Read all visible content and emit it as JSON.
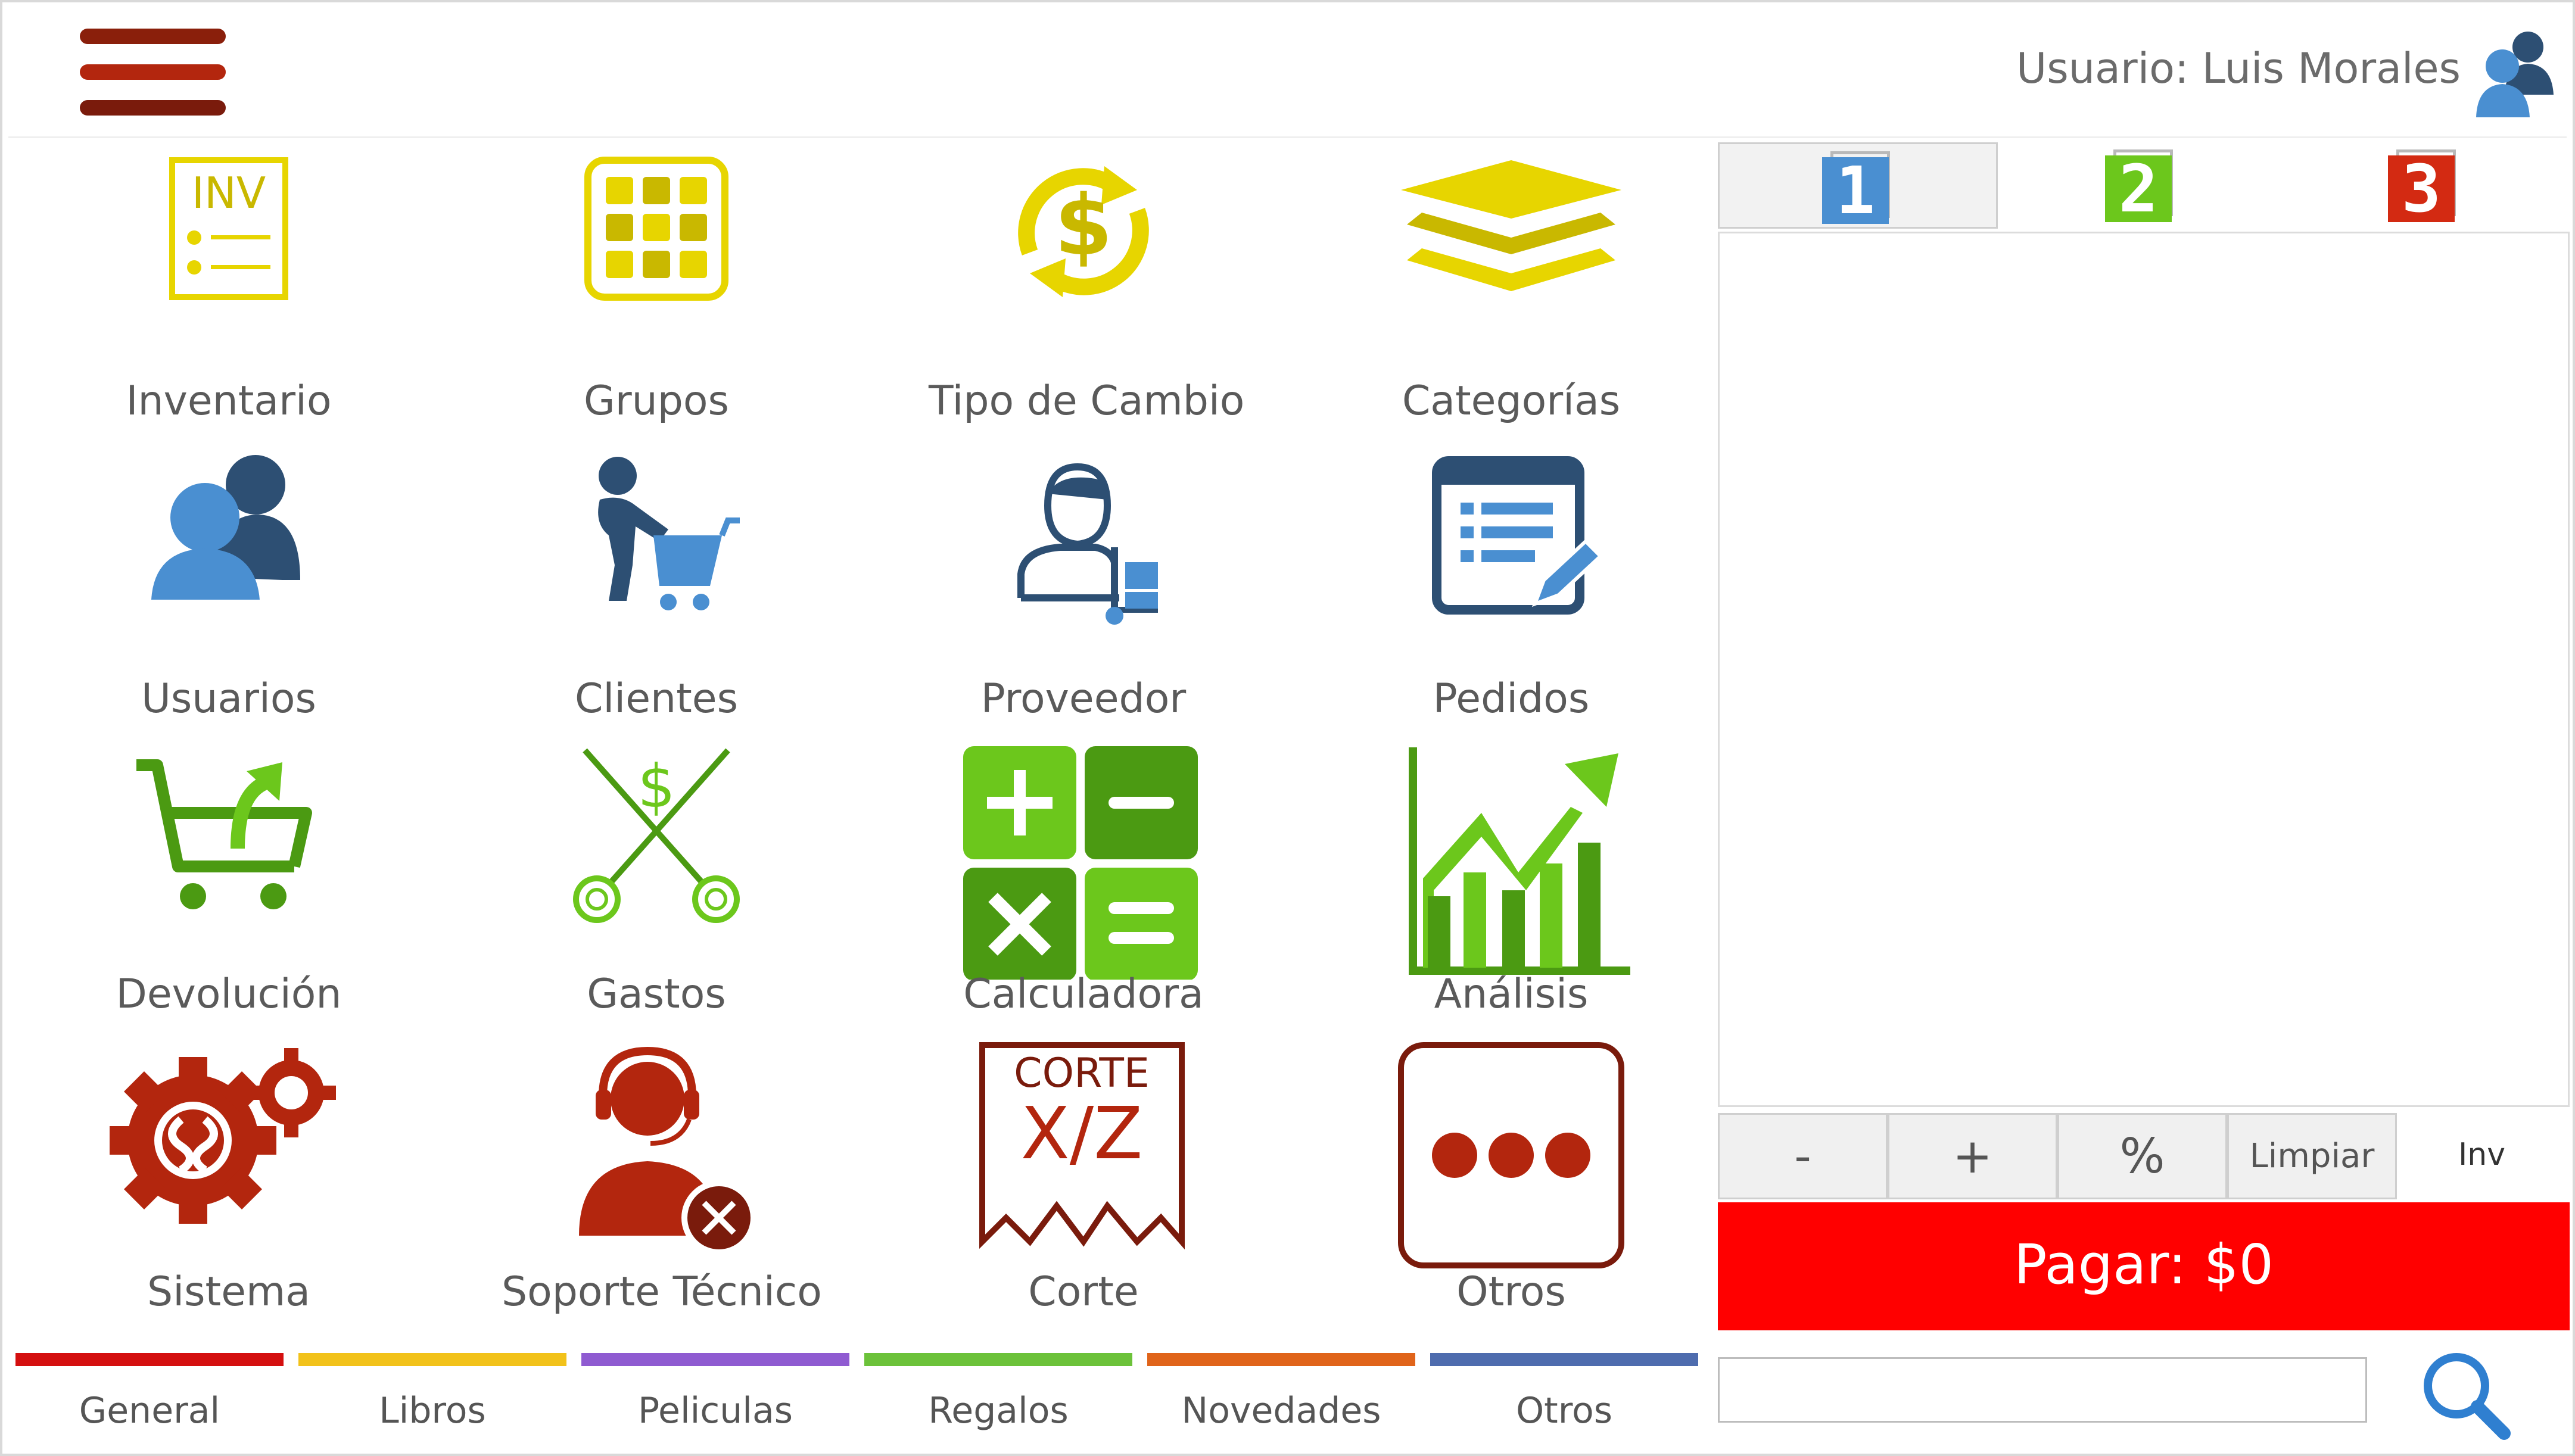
{
  "header": {
    "user_label": "Usuario: Luis Morales"
  },
  "colors": {
    "menu_dark": "#7a1b0c",
    "menu_red": "#b3260e",
    "yellow": "#e7d500",
    "yellow_dark": "#c4b300",
    "blue": "#4a8fd1",
    "navy": "#2d4f73",
    "green": "#6cc71c",
    "green_dark": "#4b9a12",
    "red": "#b3260e",
    "maroon": "#7a1b0c",
    "pay": "#ff0000"
  },
  "tiles": [
    {
      "label": "Inventario",
      "icon": "inventory-icon",
      "icon_text": "INV"
    },
    {
      "label": "Grupos",
      "icon": "groups-grid-icon"
    },
    {
      "label": "Tipo de Cambio",
      "icon": "exchange-rate-icon"
    },
    {
      "label": "Categorías",
      "icon": "layers-icon"
    },
    {
      "label": "Usuarios",
      "icon": "users-icon"
    },
    {
      "label": "Clientes",
      "icon": "customer-cart-icon"
    },
    {
      "label": "Proveedor",
      "icon": "supplier-icon"
    },
    {
      "label": "Pedidos",
      "icon": "orders-edit-icon"
    },
    {
      "label": "Devolución",
      "icon": "return-cart-icon"
    },
    {
      "label": "Gastos",
      "icon": "expenses-scissors-icon"
    },
    {
      "label": "Calculadora",
      "icon": "calculator-icon"
    },
    {
      "label": "Análisis",
      "icon": "analytics-chart-icon"
    },
    {
      "label": "Sistema",
      "icon": "system-gears-icon"
    },
    {
      "label": "Soporte Técnico",
      "icon": "tech-support-icon"
    },
    {
      "label": "Corte",
      "icon": "cut-ticket-icon",
      "icon_text_1": "CORTE",
      "icon_text_2": "X/Z"
    },
    {
      "label": "Otros",
      "icon": "more-dots-icon"
    }
  ],
  "bottom_tabs": [
    {
      "label": "General",
      "color": "#d40f0f"
    },
    {
      "label": "Libros",
      "color": "#f2c21a"
    },
    {
      "label": "Peliculas",
      "color": "#8f5bd1"
    },
    {
      "label": "Regalos",
      "color": "#6cc23a"
    },
    {
      "label": "Novedades",
      "color": "#e0641a"
    },
    {
      "label": "Otros",
      "color": "#4e6cae"
    }
  ],
  "tickets": [
    {
      "label": "1",
      "color": "#4a8fd1"
    },
    {
      "label": "2",
      "color": "#6cc71c"
    },
    {
      "label": "3",
      "color": "#d32a12"
    }
  ],
  "keypad": {
    "minus": "-",
    "plus": "+",
    "percent": "%",
    "clear": "Limpiar",
    "inv": "Inv"
  },
  "pay_label": "Pagar: $0",
  "search": {
    "value": ""
  }
}
